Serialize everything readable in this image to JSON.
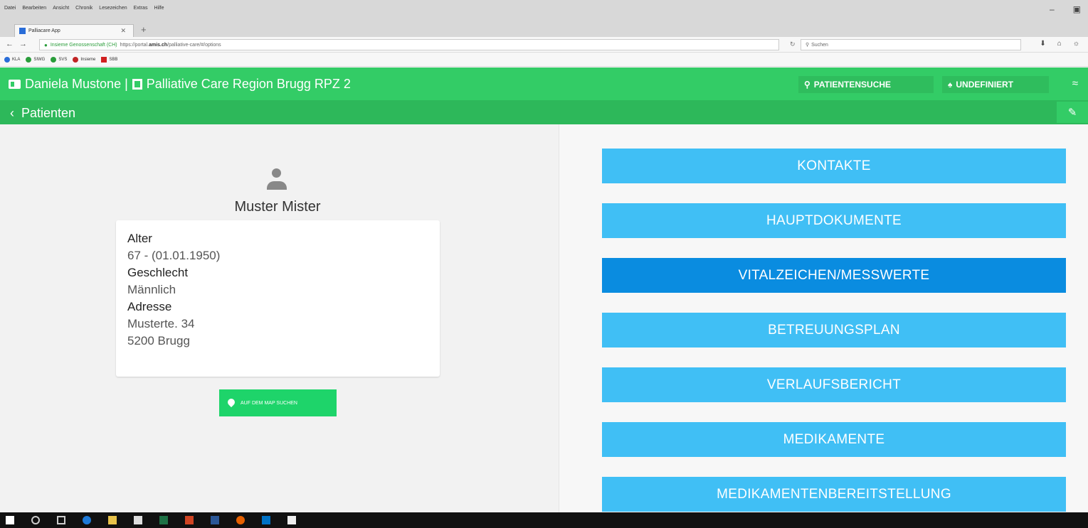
{
  "browser": {
    "menu_items": [
      "Datei",
      "Bearbeiten",
      "Ansicht",
      "Chronik",
      "Lesezeichen",
      "Extras",
      "Hilfe"
    ],
    "tab_title": "Palliacare App",
    "site_identity": "Insieme Genossenschaft (CH)",
    "url_prefix": "https://portal.",
    "url_domain": "amis.ch",
    "url_suffix": "/palliative-care/#/options",
    "search_placeholder": "Suchen",
    "bookmarks": [
      {
        "label": "KLA",
        "color": "#2a6dd8"
      },
      {
        "label": "SIWG",
        "color": "#2a9d3a"
      },
      {
        "label": "SVS",
        "color": "#2a9d3a"
      },
      {
        "label": "Insieme",
        "color": "#c02424"
      },
      {
        "label": "SBB",
        "color": "#d02020"
      }
    ]
  },
  "header": {
    "user": "Daniela Mustone |",
    "organization": "Palliative Care Region Brugg RPZ 2",
    "search_label": "PATIENTENSUCHE",
    "undefined_label": "UNDEFINIERT"
  },
  "subheader": {
    "back_label": "Patienten"
  },
  "patient": {
    "name": "Muster Mister",
    "age_label": "Alter",
    "age_value": "67 - (01.01.1950)",
    "gender_label": "Geschlecht",
    "gender_value": "Männlich",
    "address_label": "Adresse",
    "address_line1": "Musterte. 34",
    "address_line2": "5200 Brugg",
    "map_button": "AUF DEM MAP SUCHEN"
  },
  "menu": {
    "buttons": [
      {
        "label": "KONTAKTE",
        "active": false
      },
      {
        "label": "HAUPTDOKUMENTE",
        "active": false
      },
      {
        "label": "VITALZEICHEN/MESSWERTE",
        "active": true
      },
      {
        "label": "BETREUUNGSPLAN",
        "active": false
      },
      {
        "label": "VERLAUFSBERICHT",
        "active": false
      },
      {
        "label": "MEDIKAMENTE",
        "active": false
      },
      {
        "label": "MEDIKAMENTENBEREITSTELLUNG",
        "active": false
      }
    ]
  },
  "colors": {
    "header_green": "#33cc66",
    "menu_blue": "#40bff5",
    "menu_active": "#0a8ce0",
    "map_button": "#1ed46a"
  },
  "taskbar_icons": [
    "windows-icon",
    "search-icon",
    "task-view-icon",
    "edge-icon",
    "file-explorer-icon",
    "store-icon",
    "excel-icon",
    "powerpoint-icon",
    "word-icon",
    "firefox-icon",
    "outlook-icon",
    "mail-icon"
  ]
}
